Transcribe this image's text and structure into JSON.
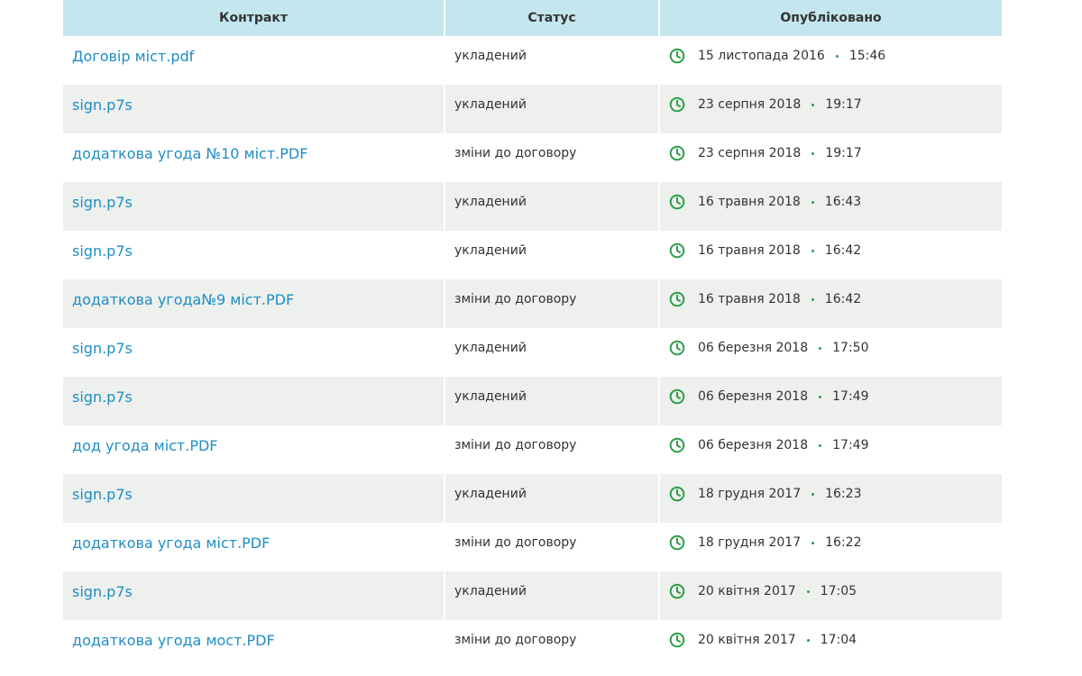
{
  "table": {
    "headers": {
      "contract": "Контракт",
      "status": "Статус",
      "published": "Опубліковано"
    },
    "rows": [
      {
        "file": "Договір міст.pdf",
        "status": "укладений",
        "date": "15 листопада 2016",
        "time": "15:46"
      },
      {
        "file": "sign.p7s",
        "status": "укладений",
        "date": "23 серпня 2018",
        "time": "19:17"
      },
      {
        "file": "додаткова угода №10 міст.PDF",
        "status": "зміни до договору",
        "date": "23 серпня 2018",
        "time": "19:17"
      },
      {
        "file": "sign.p7s",
        "status": "укладений",
        "date": "16 травня 2018",
        "time": "16:43"
      },
      {
        "file": "sign.p7s",
        "status": "укладений",
        "date": "16 травня 2018",
        "time": "16:42"
      },
      {
        "file": "додаткова угода№9 міст.PDF",
        "status": "зміни до договору",
        "date": "16 травня 2018",
        "time": "16:42"
      },
      {
        "file": "sign.p7s",
        "status": "укладений",
        "date": "06 березня 2018",
        "time": "17:50"
      },
      {
        "file": "sign.p7s",
        "status": "укладений",
        "date": "06 березня 2018",
        "time": "17:49"
      },
      {
        "file": "дод угода міст.PDF",
        "status": "зміни до договору",
        "date": "06 березня 2018",
        "time": "17:49"
      },
      {
        "file": "sign.p7s",
        "status": "укладений",
        "date": "18 грудня 2017",
        "time": "16:23"
      },
      {
        "file": "додаткова угода міст.PDF",
        "status": "зміни до договору",
        "date": "18 грудня 2017",
        "time": "16:22"
      },
      {
        "file": "sign.p7s",
        "status": "укладений",
        "date": "20 квітня 2017",
        "time": "17:05"
      },
      {
        "file": "додаткова угода мост.PDF",
        "status": "зміни до договору",
        "date": "20 квітня 2017",
        "time": "17:04"
      }
    ]
  },
  "colors": {
    "header_bg": "#c4e6ee",
    "stripe_bg": "#edf0ec",
    "link": "#1f8dc7",
    "clock_icon": "#2c9e4b"
  },
  "icons": {
    "published": "clock-icon"
  }
}
